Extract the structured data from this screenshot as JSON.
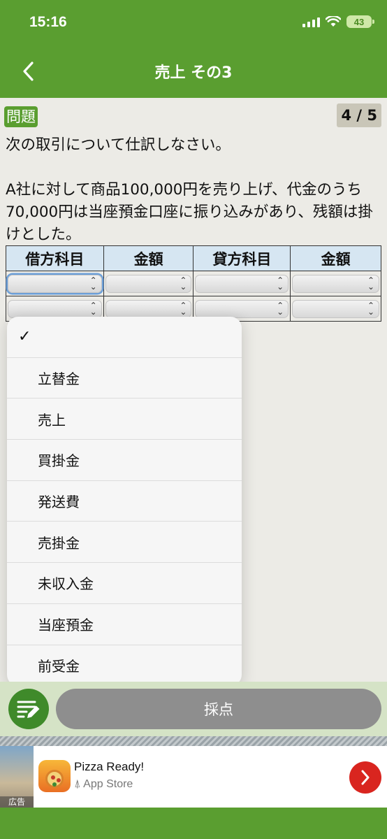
{
  "status_bar": {
    "time": "15:16",
    "battery": "43"
  },
  "nav": {
    "title": "売上 その3"
  },
  "question": {
    "badge": "問題",
    "counter": "4 / 5",
    "text": "次の取引について仕訳しなさい。\n\nA社に対して商品100,000円を売り上げ、代金のうち70,000円は当座預金口座に振り込みがあり、残額は掛けとした。"
  },
  "journal_table": {
    "headers": [
      "借方科目",
      "金額",
      "貸方科目",
      "金額"
    ]
  },
  "dropdown": {
    "checked_mark": "✓",
    "options": [
      "立替金",
      "売上",
      "買掛金",
      "発送費",
      "売掛金",
      "未収入金",
      "当座預金",
      "前受金"
    ]
  },
  "actions": {
    "grade_label": "採点"
  },
  "ad": {
    "label": "広告",
    "title": "Pizza Ready!",
    "store": "App Store"
  },
  "icons": {
    "back": "chevron-left-icon",
    "memo": "memo-pencil-icon",
    "ad_go": "chevron-right-icon",
    "store": "app-store-icon"
  },
  "colors": {
    "brand_green": "#5a9e30",
    "header_cell": "#d6e6f2",
    "grade_button": "#8e8e8e",
    "ad_arrow": "#d9251f"
  }
}
